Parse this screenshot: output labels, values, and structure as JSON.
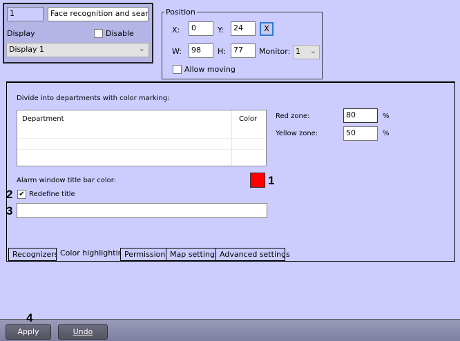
{
  "top_panel": {
    "id_value": "1",
    "name_value": "Face recognition and search ",
    "display_label": "Display",
    "disable_label": "Disable",
    "disable_checked": false,
    "display_select": "Display 1"
  },
  "position": {
    "title": "Position",
    "x_label": "X:",
    "x_value": "0",
    "y_label": "Y:",
    "y_value": "24",
    "w_label": "W:",
    "w_value": "98",
    "h_label": "H:",
    "h_value": "77",
    "monitor_label": "Monitor:",
    "monitor_value": "1",
    "reset_label": "X",
    "allow_moving_label": "Allow moving",
    "allow_moving_checked": false
  },
  "color_tab": {
    "divide_label": "Divide into departments with color marking:",
    "table_headers": [
      "Department",
      "Color"
    ],
    "red_zone_label": "Red zone:",
    "red_zone_value": "80",
    "yellow_zone_label": "Yellow zone:",
    "yellow_zone_value": "50",
    "percent": "%",
    "alarm_color_label": "Alarm window title bar color:",
    "alarm_color": "#ff0000",
    "redefine_label": "Redefine title",
    "redefine_checked": true,
    "title_value": ""
  },
  "annotations": {
    "a1": "1",
    "a2": "2",
    "a3": "3",
    "a4": "4"
  },
  "tabs": [
    {
      "label": "Recognizers"
    },
    {
      "label": "Color highlighting",
      "active": true
    },
    {
      "label": "Permissions"
    },
    {
      "label": "Map settings"
    },
    {
      "label": "Advanced settings"
    }
  ],
  "buttons": {
    "apply": "Apply",
    "undo": "Undo"
  }
}
